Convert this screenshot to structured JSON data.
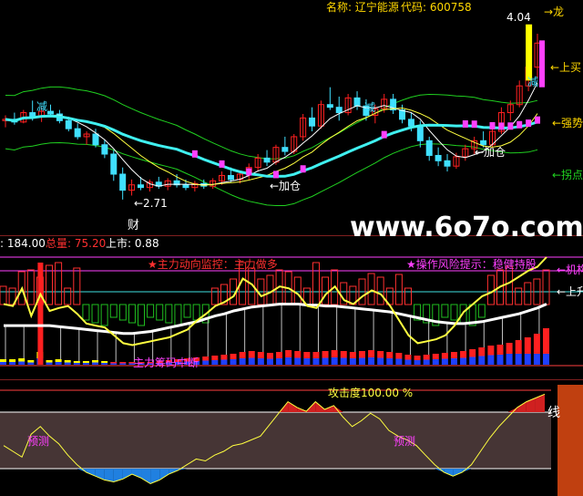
{
  "header": {
    "name_label": "名称: 辽宁能源",
    "code_label": "代码: 600758",
    "text_color": "#FFD700"
  },
  "main_panel": {
    "labels": {
      "reduce_top": "减",
      "reduce_mid": "减",
      "reduce_right": "减",
      "jiacang_1": "←加仓",
      "jiacang_2": "←加仓",
      "low_price": "←2.71",
      "top_price": "4.04",
      "dragon": "→龙",
      "buy": "←上买",
      "strong": "←强势",
      "turning": "←拐点",
      "cai": "财"
    },
    "colors": {
      "up": "#FF2020",
      "down": "#40E0FF",
      "ma_fast": "#FFFFFF",
      "ma_mid": "#FFFF40",
      "ma_slow": "#40F0F0",
      "band": "#20D020",
      "marker": "#FF40FF"
    },
    "candles": [
      [
        3.3,
        3.34,
        3.25,
        3.31
      ],
      [
        3.31,
        3.36,
        3.27,
        3.29
      ],
      [
        3.29,
        3.38,
        3.28,
        3.36
      ],
      [
        3.36,
        3.45,
        3.3,
        3.33
      ],
      [
        3.33,
        3.4,
        3.29,
        3.37
      ],
      [
        3.37,
        3.42,
        3.33,
        3.35
      ],
      [
        3.35,
        3.38,
        3.28,
        3.3
      ],
      [
        3.3,
        3.33,
        3.22,
        3.24
      ],
      [
        3.24,
        3.28,
        3.16,
        3.18
      ],
      [
        3.18,
        3.22,
        3.12,
        3.2
      ],
      [
        3.2,
        3.24,
        3.1,
        3.12
      ],
      [
        3.12,
        3.16,
        3.02,
        3.05
      ],
      [
        3.05,
        3.08,
        2.85,
        2.9
      ],
      [
        2.9,
        2.95,
        2.71,
        2.78
      ],
      [
        2.78,
        2.86,
        2.74,
        2.82
      ],
      [
        2.82,
        2.88,
        2.78,
        2.8
      ],
      [
        2.8,
        2.86,
        2.77,
        2.84
      ],
      [
        2.84,
        2.88,
        2.79,
        2.81
      ],
      [
        2.81,
        2.87,
        2.78,
        2.85
      ],
      [
        2.85,
        2.9,
        2.8,
        2.82
      ],
      [
        2.82,
        2.86,
        2.78,
        2.8
      ],
      [
        2.8,
        2.85,
        2.77,
        2.83
      ],
      [
        2.83,
        2.86,
        2.79,
        2.81
      ],
      [
        2.81,
        2.87,
        2.79,
        2.85
      ],
      [
        2.85,
        2.92,
        2.82,
        2.89
      ],
      [
        2.89,
        2.95,
        2.84,
        2.86
      ],
      [
        2.86,
        2.92,
        2.83,
        2.9
      ],
      [
        2.9,
        2.98,
        2.86,
        2.95
      ],
      [
        2.95,
        3.05,
        2.92,
        3.02
      ],
      [
        3.02,
        3.08,
        2.96,
        2.99
      ],
      [
        2.99,
        3.12,
        2.97,
        3.1
      ],
      [
        3.1,
        3.18,
        3.04,
        3.07
      ],
      [
        3.07,
        3.2,
        3.05,
        3.18
      ],
      [
        3.18,
        3.35,
        3.15,
        3.32
      ],
      [
        3.32,
        3.4,
        3.22,
        3.26
      ],
      [
        3.26,
        3.45,
        3.24,
        3.42
      ],
      [
        3.42,
        3.55,
        3.38,
        3.4
      ],
      [
        3.4,
        3.48,
        3.3,
        3.36
      ],
      [
        3.36,
        3.5,
        3.34,
        3.47
      ],
      [
        3.47,
        3.52,
        3.38,
        3.41
      ],
      [
        3.41,
        3.46,
        3.3,
        3.34
      ],
      [
        3.34,
        3.42,
        3.28,
        3.39
      ],
      [
        3.39,
        3.5,
        3.36,
        3.46
      ],
      [
        3.46,
        3.5,
        3.35,
        3.38
      ],
      [
        3.38,
        3.42,
        3.28,
        3.31
      ],
      [
        3.31,
        3.36,
        3.22,
        3.26
      ],
      [
        3.26,
        3.3,
        3.1,
        3.15
      ],
      [
        3.15,
        3.18,
        3.0,
        3.04
      ],
      [
        3.04,
        3.1,
        2.96,
        3.0
      ],
      [
        3.0,
        3.05,
        2.92,
        2.96
      ],
      [
        2.96,
        3.06,
        2.94,
        3.03
      ],
      [
        3.03,
        3.12,
        3.0,
        3.09
      ],
      [
        3.09,
        3.18,
        3.05,
        3.15
      ],
      [
        3.15,
        3.22,
        3.1,
        3.12
      ],
      [
        3.12,
        3.25,
        3.1,
        3.22
      ],
      [
        3.22,
        3.4,
        3.2,
        3.36
      ],
      [
        3.36,
        3.45,
        3.3,
        3.42
      ],
      [
        3.42,
        3.6,
        3.4,
        3.56
      ],
      [
        3.56,
        3.75,
        3.52,
        3.7
      ],
      [
        3.7,
        3.95,
        3.62,
        3.88
      ]
    ]
  },
  "middle_panel": {
    "stats": {
      "prefix": ": 184.00",
      "total_label": "总量: 75.20",
      "market_label": "上市: 0.88"
    },
    "labels": {
      "main_force": "★主力动向监控：主力做多",
      "risk_tip": "★操作风险提示：稳健持股",
      "chip_break": "主力筹码中断",
      "right_1": "←机构",
      "right_2": "←上升"
    },
    "colors": {
      "bar_up": "#FF2020",
      "bar_down": "#2040FF",
      "yellow": "#FFFF40",
      "white": "#FFFFFF",
      "magenta": "#FF40FF",
      "box_green": "#20C020",
      "box_red": "#FF3030",
      "cyan_line": "#40E0E0"
    },
    "oscillator": [
      62,
      60,
      78,
      50,
      72,
      55,
      58,
      60,
      52,
      42,
      40,
      38,
      30,
      22,
      20,
      22,
      24,
      26,
      28,
      32,
      36,
      45,
      52,
      60,
      64,
      70,
      88,
      82,
      70,
      74,
      80,
      78,
      72,
      60,
      58,
      72,
      80,
      66,
      62,
      70,
      76,
      72,
      60,
      45,
      30,
      22,
      24,
      26,
      30,
      40,
      54,
      62,
      70,
      74,
      80,
      84,
      90,
      96,
      100,
      110
    ],
    "ma_line": [
      40,
      40,
      40,
      40,
      40,
      40,
      39,
      38,
      37,
      36,
      35,
      34,
      33,
      32,
      32,
      33,
      34,
      36,
      38,
      40,
      42,
      44,
      47,
      50,
      52,
      55,
      57,
      59,
      60,
      61,
      62,
      62,
      62,
      61,
      61,
      60,
      60,
      59,
      58,
      57,
      56,
      55,
      54,
      52,
      50,
      48,
      46,
      44,
      43,
      42,
      42,
      43,
      44,
      46,
      48,
      50,
      52,
      55,
      58,
      62
    ],
    "volume": [
      6,
      6,
      7,
      5,
      14,
      5,
      6,
      5,
      4,
      4,
      5,
      4,
      3,
      3,
      3,
      3,
      3,
      4,
      5,
      6,
      7,
      8,
      9,
      10,
      11,
      12,
      14,
      15,
      14,
      13,
      14,
      16,
      15,
      14,
      14,
      15,
      16,
      15,
      14,
      15,
      16,
      15,
      14,
      13,
      11,
      10,
      11,
      12,
      13,
      14,
      15,
      17,
      19,
      21,
      22,
      24,
      27,
      30,
      34,
      40
    ]
  },
  "bottom_panel": {
    "attack_label": "攻击度100.00 %",
    "forecast_1": "预测",
    "forecast_2": "预测",
    "right_label": "线",
    "colors": {
      "yellow": "#FFFF40",
      "red": "#D02020",
      "blue": "#2080E0",
      "magenta": "#FF40FF",
      "band": "#806060",
      "right_bar": "#C04010"
    },
    "line": [
      50,
      44,
      38,
      62,
      70,
      60,
      52,
      40,
      30,
      22,
      18,
      14,
      12,
      15,
      20,
      16,
      10,
      14,
      20,
      24,
      30,
      36,
      34,
      40,
      44,
      50,
      52,
      56,
      60,
      72,
      84,
      96,
      90,
      86,
      96,
      88,
      92,
      80,
      70,
      76,
      84,
      78,
      66,
      60,
      56,
      50,
      40,
      30,
      22,
      18,
      22,
      30,
      44,
      58,
      70,
      80,
      90,
      96,
      100,
      104
    ]
  },
  "watermark": "www.6o7o.com"
}
